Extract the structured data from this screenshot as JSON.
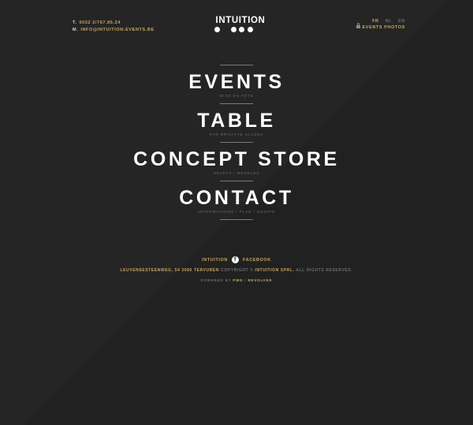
{
  "header": {
    "phone_label": "T.",
    "phone": "0032 2/767.85.24",
    "email_label": "M.",
    "email": "INFO@INTUITION-EVENTS.BE",
    "logo": "INTUITION",
    "languages": [
      "FR",
      "NL",
      "EN"
    ],
    "active_language": "FR",
    "photos_link": "EVENTS PHOTOS"
  },
  "menu": [
    {
      "title": "EVENTS",
      "subtitle": "MISE EN FÊTE"
    },
    {
      "title": "TABLE",
      "subtitle": "PAR BRIGITTE ULLENS"
    },
    {
      "title": "CONCEPT STORE",
      "subtitle": "OBJETS / MEUBLES"
    },
    {
      "title": "CONTACT",
      "subtitle": "INFORMATIONS / PLAN / EQUIPE"
    }
  ],
  "footer": {
    "social_left": "INTUITION",
    "social_right": "FACEBOOK",
    "address": "LEUVENSESTEENWEG, 54 3080 TERVUREN",
    "copyright_prefix": "COPYRIGHT ©",
    "company": "INTUITION SPRL.",
    "rights": "ALL RIGHTS RESERVED.",
    "powered_by": "POWERED BY",
    "pwd": "PWD",
    "sep": "/",
    "revolver": "REVOLVER"
  },
  "colors": {
    "background": "#252525",
    "accent": "#c7a764",
    "text": "#ffffff"
  },
  "icons": {
    "facebook": "facebook-icon",
    "lock": "lock-icon"
  }
}
